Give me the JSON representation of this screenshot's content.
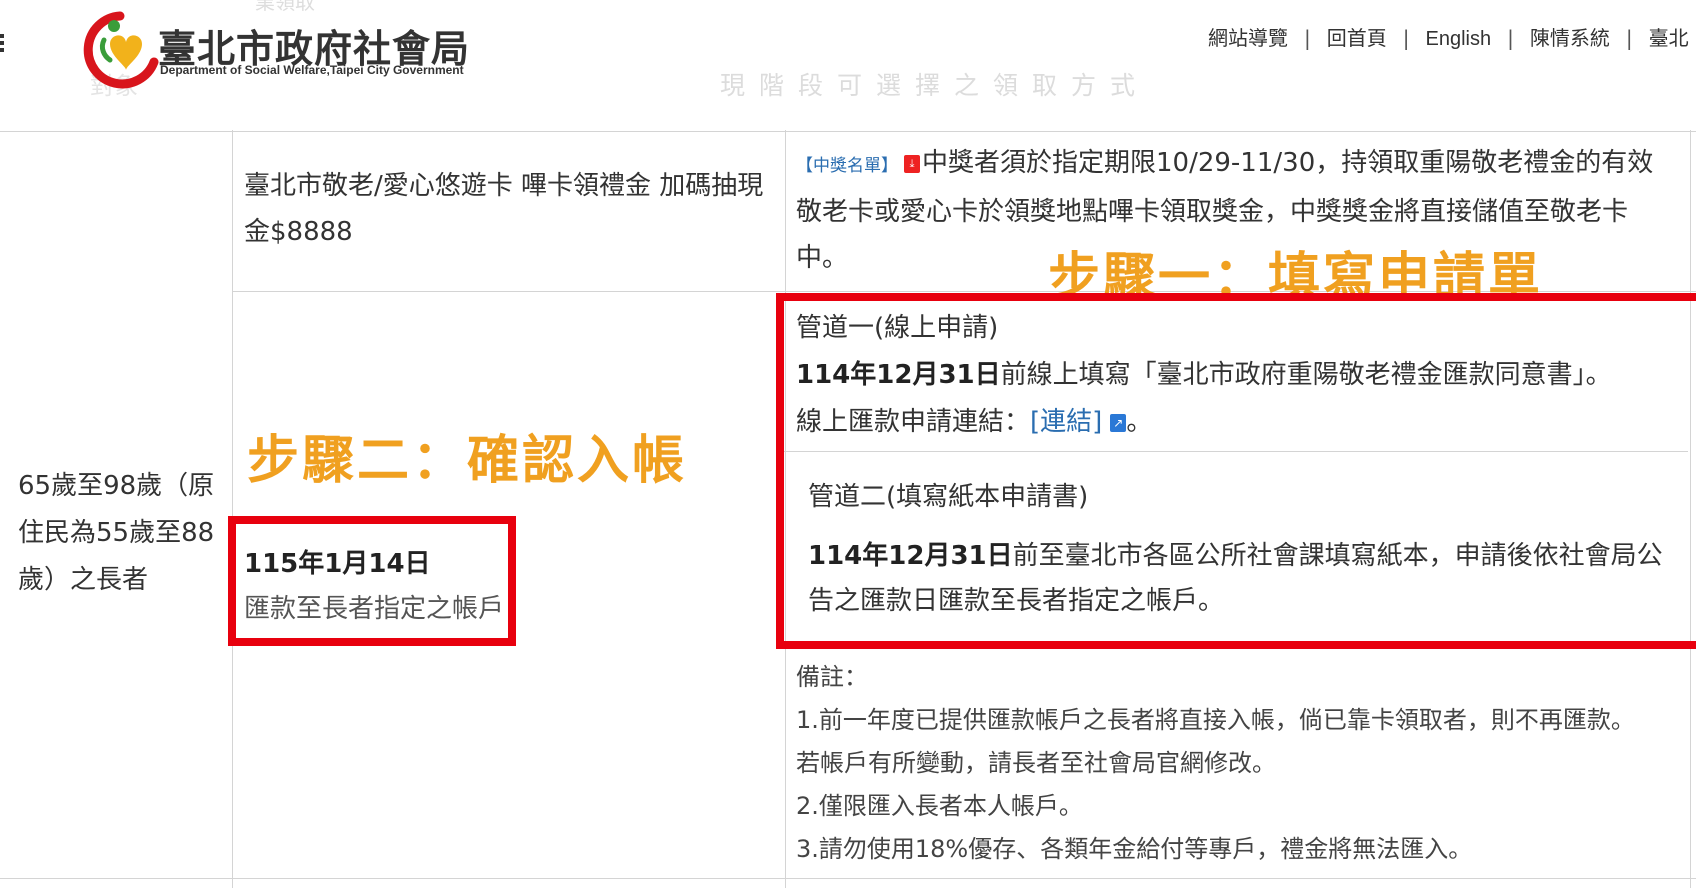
{
  "header": {
    "site_title": "臺北市政府社會局",
    "site_subtitle": "Department of Social Welfare,Taipei City Government",
    "ghost_top": "業領取",
    "ghost_left": "對象",
    "ghost_column_header": "現階段可選擇之領取方式",
    "nav": [
      "網站導覽",
      "回首頁",
      "English",
      "陳情系統",
      "臺北"
    ]
  },
  "table": {
    "age_group": "65歲至98歲（原住民為55歲至88歲）之長者",
    "card_method": "臺北市敬老/愛心悠遊卡 嗶卡領禮金 加碼抽現金$8888",
    "winner": {
      "tag": "【中獎名單】",
      "text": "中獎者須於指定期限10/29-11/30，持領取重陽敬老禮金的有效敬老卡或愛心卡於領獎地點嗶卡領取獎金，中獎獎金將直接儲值至敬老卡中。"
    },
    "step1_label": "步驟一：填寫申請單",
    "step2_label": "步驟二：確認入帳",
    "transfer": {
      "date": "115年1月14日",
      "desc": "匯款至長者指定之帳戶"
    },
    "channel1": {
      "title": "管道一(線上申請)",
      "date": "114年12月31日",
      "text": "前線上填寫「臺北市政府重陽敬老禮金匯款同意書」。",
      "link_prefix": "線上匯款申請連結：",
      "link_text": "[連結]",
      "link_suffix": "。"
    },
    "channel2": {
      "title": "管道二(填寫紙本申請書)",
      "date": "114年12月31日",
      "text_line1": "前至臺北市各區公所社會課填寫紙本，申請後依社會局公",
      "text_line2": "告之匯款日匯款至長者指定之帳戶。"
    },
    "notes": {
      "title": "備註：",
      "items": [
        "1.前一年度已提供匯款帳戶之長者將直接入帳，倘已靠卡領取者，則不再匯款。",
        "若帳戶有所變動，請長者至社會局官網修改。",
        "2.僅限匯入長者本人帳戶。",
        "3.請勿使用18%優存、各類年金給付等專戶，禮金將無法匯入。"
      ]
    }
  },
  "colors": {
    "accent_orange": "#f0a020",
    "highlight_red": "#e8000e",
    "link_blue": "#2a6db0"
  },
  "icons": [
    "menu-icon",
    "logo-mark",
    "pdf-icon",
    "external-link-icon"
  ]
}
